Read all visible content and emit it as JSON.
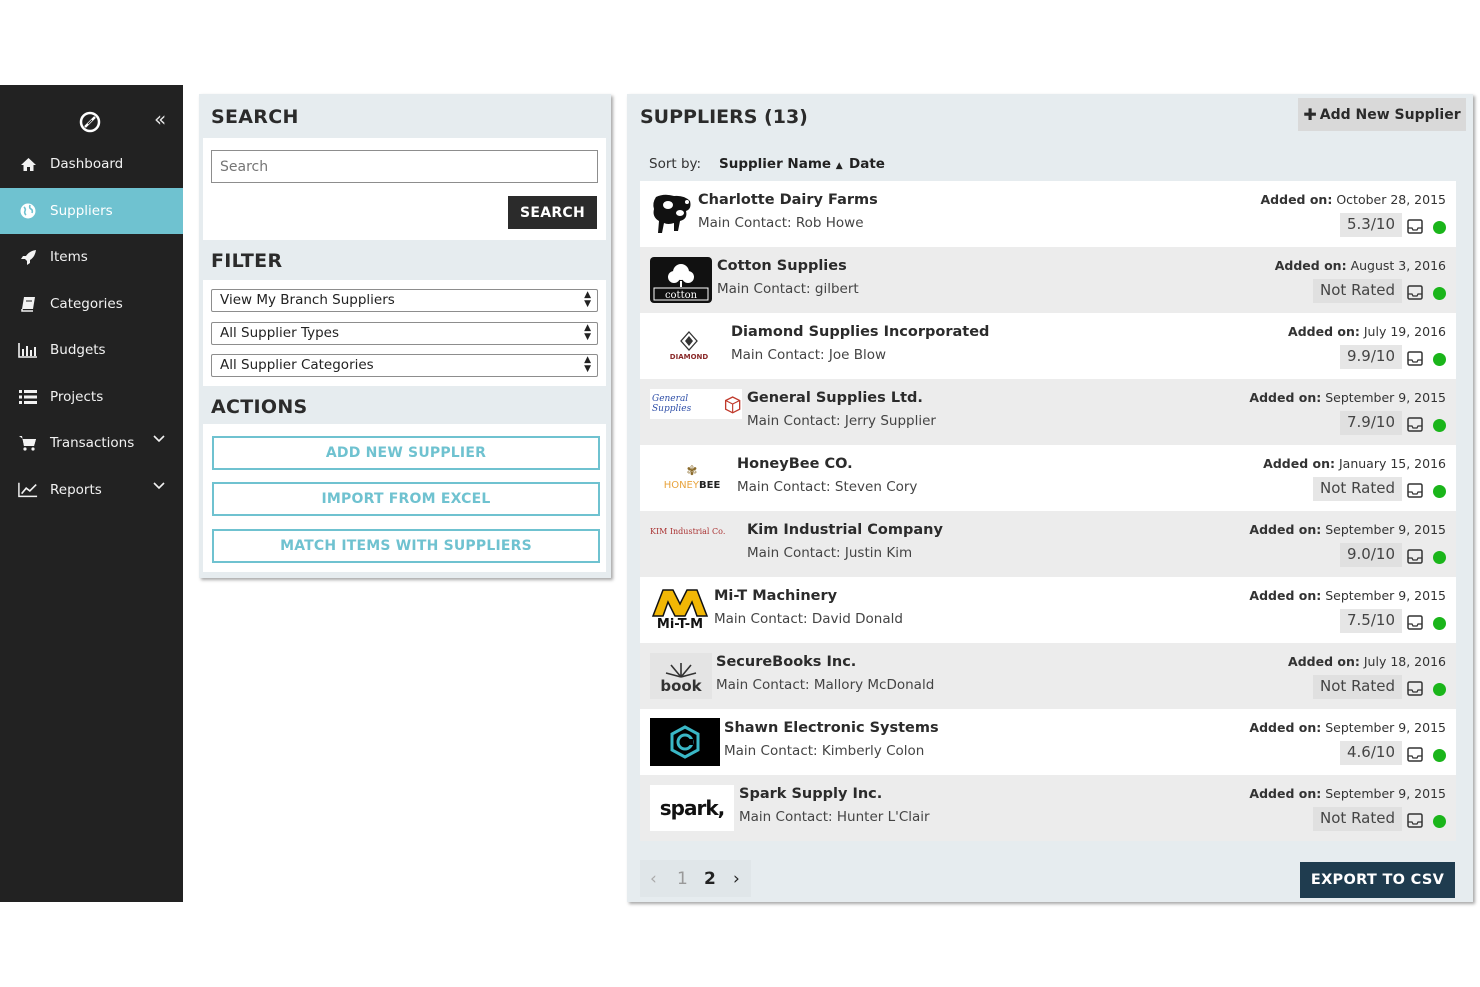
{
  "sidebar": {
    "items": [
      {
        "label": "Dashboard",
        "icon": "home-icon"
      },
      {
        "label": "Suppliers",
        "icon": "globe-icon",
        "active": true
      },
      {
        "label": "Items",
        "icon": "rocket-icon"
      },
      {
        "label": "Categories",
        "icon": "book-icon"
      },
      {
        "label": "Budgets",
        "icon": "bar-chart-icon"
      },
      {
        "label": "Projects",
        "icon": "list-icon"
      },
      {
        "label": "Transactions",
        "icon": "cart-icon",
        "has_chevron": true
      },
      {
        "label": "Reports",
        "icon": "line-chart-icon",
        "has_chevron": true
      }
    ],
    "collapse_glyph": "«"
  },
  "search": {
    "title": "SEARCH",
    "placeholder": "Search",
    "button_label": "SEARCH"
  },
  "filter": {
    "title": "FILTER",
    "selects": [
      "View My Branch Suppliers",
      "All Supplier Types",
      "All Supplier Categories"
    ]
  },
  "actions": {
    "title": "ACTIONS",
    "buttons": [
      "ADD NEW SUPPLIER",
      "IMPORT FROM EXCEL",
      "MATCH ITEMS WITH SUPPLIERS"
    ]
  },
  "suppliers": {
    "title": "SUPPLIERS (13)",
    "add_button": "Add New Supplier",
    "sort_label": "Sort by:",
    "sort_name": "Supplier Name",
    "sort_date": "Date",
    "added_label": "Added on:",
    "contact_prefix": "Main Contact:",
    "rows": [
      {
        "name": "Charlotte Dairy Farms",
        "contact": "Main Contact: Rob Howe",
        "date": "October 28, 2015",
        "rating": "5.3/10",
        "logo": "cow-logo"
      },
      {
        "name": "Cotton Supplies",
        "contact": "Main Contact: gilbert",
        "date": "August 3, 2016",
        "rating": "Not Rated",
        "logo": "cotton-logo"
      },
      {
        "name": "Diamond Supplies Incorporated",
        "contact": "Main Contact: Joe Blow",
        "date": "July 19, 2016",
        "rating": "9.9/10",
        "logo": "diamond-logo"
      },
      {
        "name": "General Supplies Ltd.",
        "contact": "Main Contact: Jerry Supplier",
        "date": "September 9, 2015",
        "rating": "7.9/10",
        "logo": "general-supplies-logo"
      },
      {
        "name": "HoneyBee CO.",
        "contact": "Main Contact: Steven Cory",
        "date": "January 15, 2016",
        "rating": "Not Rated",
        "logo": "honeybee-logo"
      },
      {
        "name": "Kim Industrial Company",
        "contact": "Main Contact: Justin Kim",
        "date": "September 9, 2015",
        "rating": "9.0/10",
        "logo": "kim-industrial-logo"
      },
      {
        "name": "Mi-T Machinery",
        "contact": "Main Contact: David Donald",
        "date": "September 9, 2015",
        "rating": "7.5/10",
        "logo": "mitm-logo"
      },
      {
        "name": "SecureBooks Inc.",
        "contact": "Main Contact: Mallory McDonald",
        "date": "July 18, 2016",
        "rating": "Not Rated",
        "logo": "book-logo"
      },
      {
        "name": "Shawn Electronic Systems",
        "contact": "Main Contact: Kimberly Colon",
        "date": "September 9, 2015",
        "rating": "4.6/10",
        "logo": "shawn-electronic-logo"
      },
      {
        "name": "Spark Supply Inc.",
        "contact": "Main Contact: Hunter L'Clair",
        "date": "September 9, 2015",
        "rating": "Not Rated",
        "logo": "spark-logo"
      }
    ]
  },
  "pagination": {
    "prev": "‹",
    "pages": [
      "1",
      "2"
    ],
    "current": "2",
    "next": "›"
  },
  "export_button": "EXPORT TO CSV",
  "logo_text": {
    "cotton": "cotton",
    "diamond": "DIAMOND",
    "general": "General Supplies",
    "honey": "HONEY",
    "bee": "BEE",
    "kim": "KIM Industrial Co.",
    "mitm": "Mi-T-M",
    "book": "book",
    "spark": "spark,"
  },
  "colors": {
    "sidebar_bg": "#222222",
    "active_nav": "#6fc2d0",
    "panel_bg": "#e6ecef",
    "status_green": "#1ab51a",
    "export_bg": "#1f3c4f"
  }
}
